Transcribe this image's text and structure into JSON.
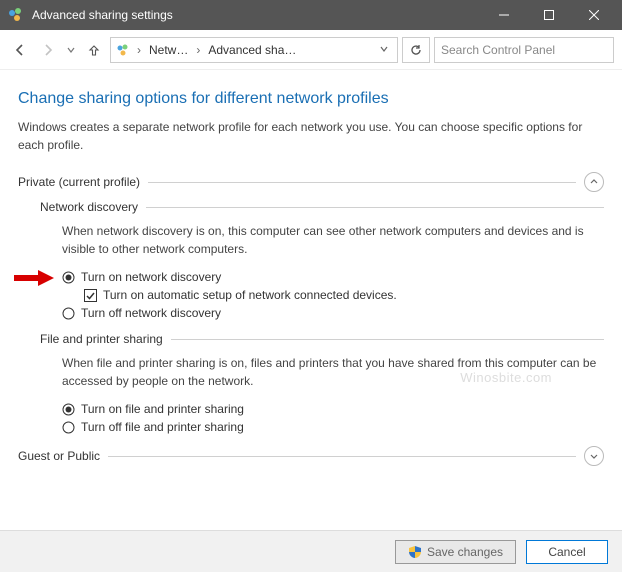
{
  "window": {
    "title": "Advanced sharing settings"
  },
  "breadcrumb": {
    "item1": "Netw…",
    "item2": "Advanced sha…"
  },
  "search": {
    "placeholder": "Search Control Panel"
  },
  "page": {
    "heading": "Change sharing options for different network profiles",
    "intro": "Windows creates a separate network profile for each network you use. You can choose specific options for each profile."
  },
  "profiles": {
    "private": {
      "label": "Private (current profile)",
      "network_discovery": {
        "title": "Network discovery",
        "desc": "When network discovery is on, this computer can see other network computers and devices and is visible to other network computers.",
        "opt_on": "Turn on network discovery",
        "opt_auto": "Turn on automatic setup of network connected devices.",
        "opt_off": "Turn off network discovery"
      },
      "file_printer": {
        "title": "File and printer sharing",
        "desc": "When file and printer sharing is on, files and printers that you have shared from this computer can be accessed by people on the network.",
        "opt_on": "Turn on file and printer sharing",
        "opt_off": "Turn off file and printer sharing"
      }
    },
    "guest": {
      "label": "Guest or Public"
    }
  },
  "footer": {
    "save": "Save changes",
    "cancel": "Cancel"
  },
  "watermark": "Winosbite.com"
}
